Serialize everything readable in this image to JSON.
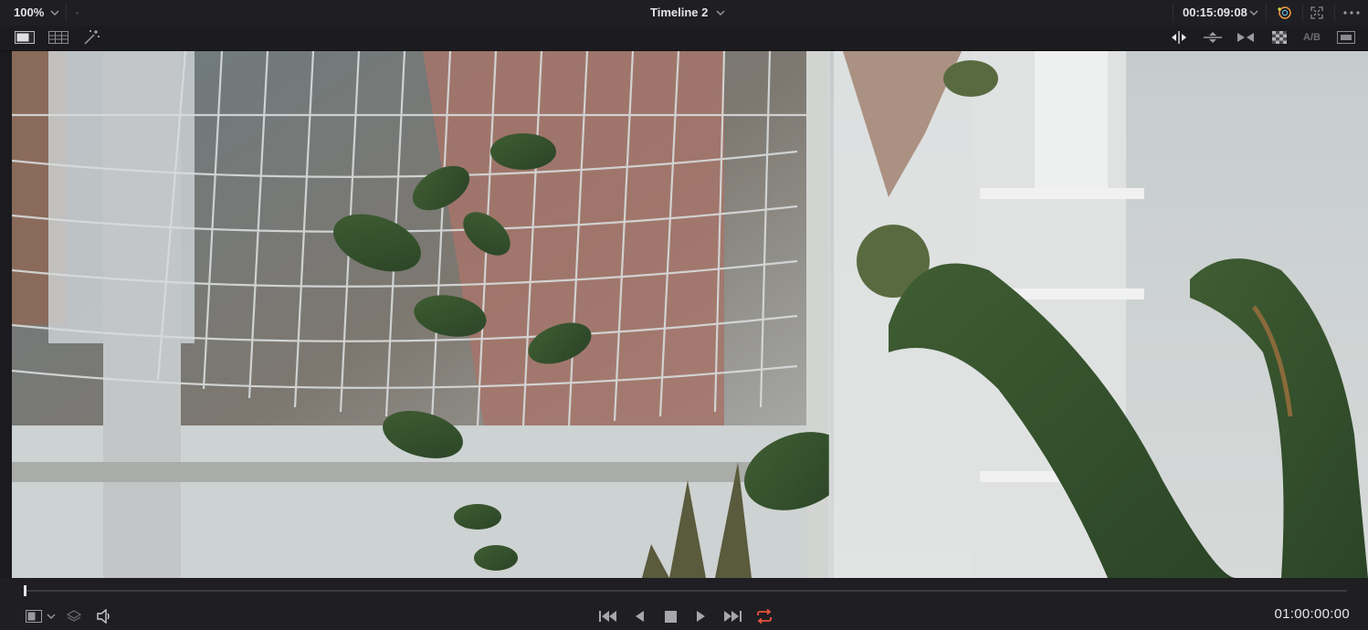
{
  "header": {
    "zoom_value": "100%",
    "timeline_name": "Timeline 2",
    "source_timecode": "00:15:09:08"
  },
  "toolbar": {
    "ab_label": "A/B"
  },
  "transport": {
    "current_timecode": "01:00:00:00",
    "loop_color": "#e5533d"
  },
  "icons": {
    "zoom_dropdown": "chevron-down-icon",
    "timeline_dropdown": "chevron-down-icon",
    "timecode_dropdown": "chevron-down-icon",
    "color_gallery": "color-wheel-icon",
    "fullscreen": "expand-icon",
    "more": "more-dots-icon",
    "single_viewer": "single-viewer-icon",
    "gallery_grid": "gallery-grid-icon",
    "magic_wand": "magic-wand-icon",
    "split_vertical": "split-vertical-icon",
    "split_horizontal": "split-horizontal-icon",
    "wipe_mirror": "wipe-mirror-icon",
    "checkerboard": "checkerboard-icon",
    "overlay": "overlay-icon",
    "viewer_mode": "viewer-mode-icon",
    "layers": "layers-icon",
    "volume": "speaker-icon",
    "first_frame": "skip-back-icon",
    "play_reverse": "play-reverse-icon",
    "stop": "stop-icon",
    "play": "play-icon",
    "last_frame": "skip-forward-icon",
    "loop": "loop-icon"
  }
}
